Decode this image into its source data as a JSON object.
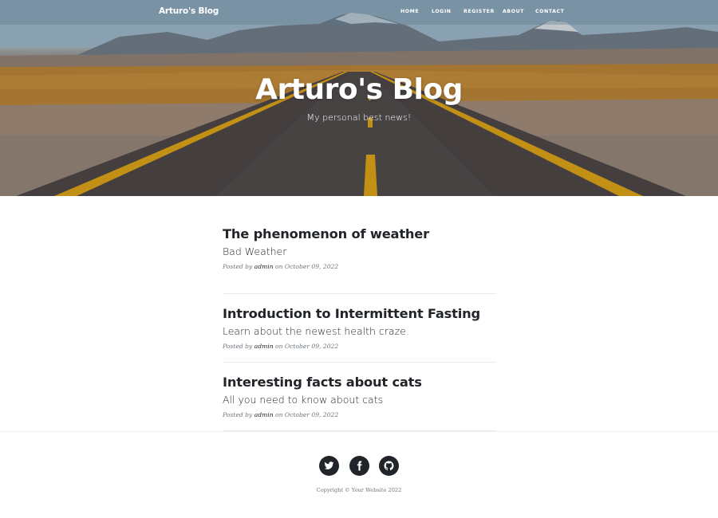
{
  "navbar": {
    "brand": "Arturo's Blog",
    "links": [
      "HOME",
      "LOGIN",
      "REGISTER",
      "ABOUT",
      "CONTACT"
    ]
  },
  "hero": {
    "title": "Arturo's Blog",
    "subtitle": "My personal best news!"
  },
  "posts": [
    {
      "title": "The phenomenon of weather",
      "subtitle": "Bad Weather",
      "meta_prefix": "Posted by",
      "author": "admin",
      "meta_on": "on",
      "date": "October 09, 2022"
    },
    {
      "title": "Introduction to Intermittent Fasting",
      "subtitle": "Learn about the newest health craze.",
      "meta_prefix": "Posted by",
      "author": "admin",
      "meta_on": "on",
      "date": "October 09, 2022"
    },
    {
      "title": "Interesting facts about cats",
      "subtitle": "All you need to know about cats",
      "meta_prefix": "Posted by",
      "author": "admin",
      "meta_on": "on",
      "date": "October 09, 2022"
    }
  ],
  "footer": {
    "social": [
      "twitter-icon",
      "facebook-icon",
      "github-icon"
    ],
    "copyright": "Copyright © Your Website 2022"
  },
  "colors": {
    "text": "#212529",
    "muted": "#6c757d",
    "road_line": "#e0a61a"
  }
}
